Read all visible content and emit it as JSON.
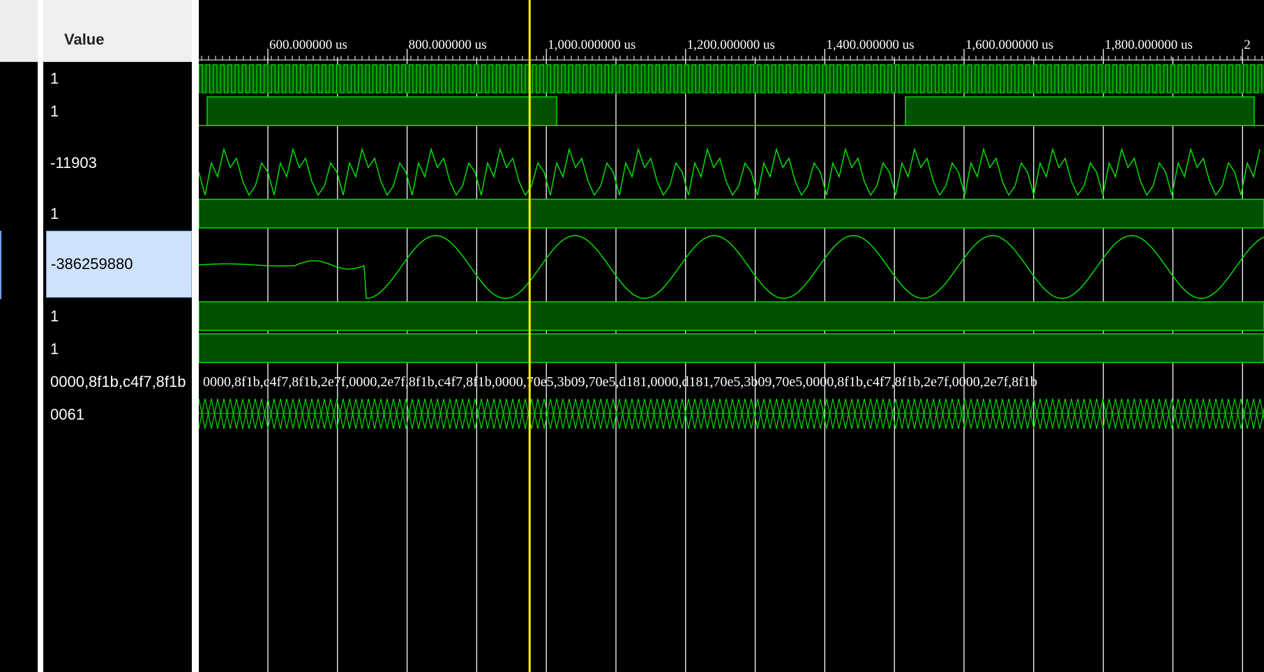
{
  "value_panel": {
    "header": "Value",
    "values": [
      "1",
      "1",
      "-11903",
      "1",
      "-386259880",
      "1",
      "1",
      "0000,8f1b,c4f7,8f1b",
      "0061"
    ],
    "selected_index": 4
  },
  "timeline": {
    "unit": "us",
    "tick_labels": [
      "600.000000 us",
      "800.000000 us",
      "1,000.000000 us",
      "1,200.000000 us",
      "1,400.000000 us",
      "1,600.000000 us",
      "1,800.000000 us",
      "2"
    ],
    "cursor_time_us": 976
  },
  "waves": {
    "bus_text": "0000,8f1b,c4f7,8f1b,2e7f,0000,2e7f,8f1b,c4f7,8f1b,0000,70e5,3b09,70e5,d181,0000,d181,70e5,3b09,70e5,0000,8f1b,c4f7,8f1b,2e7f,0000,2e7f,8f1b"
  },
  "colors": {
    "wave": "#00e000",
    "wave_fill": "#005000",
    "cursor": "#ffff00",
    "grid": "#ffffff",
    "selection": "#cfe2fb",
    "background": "#000000"
  }
}
